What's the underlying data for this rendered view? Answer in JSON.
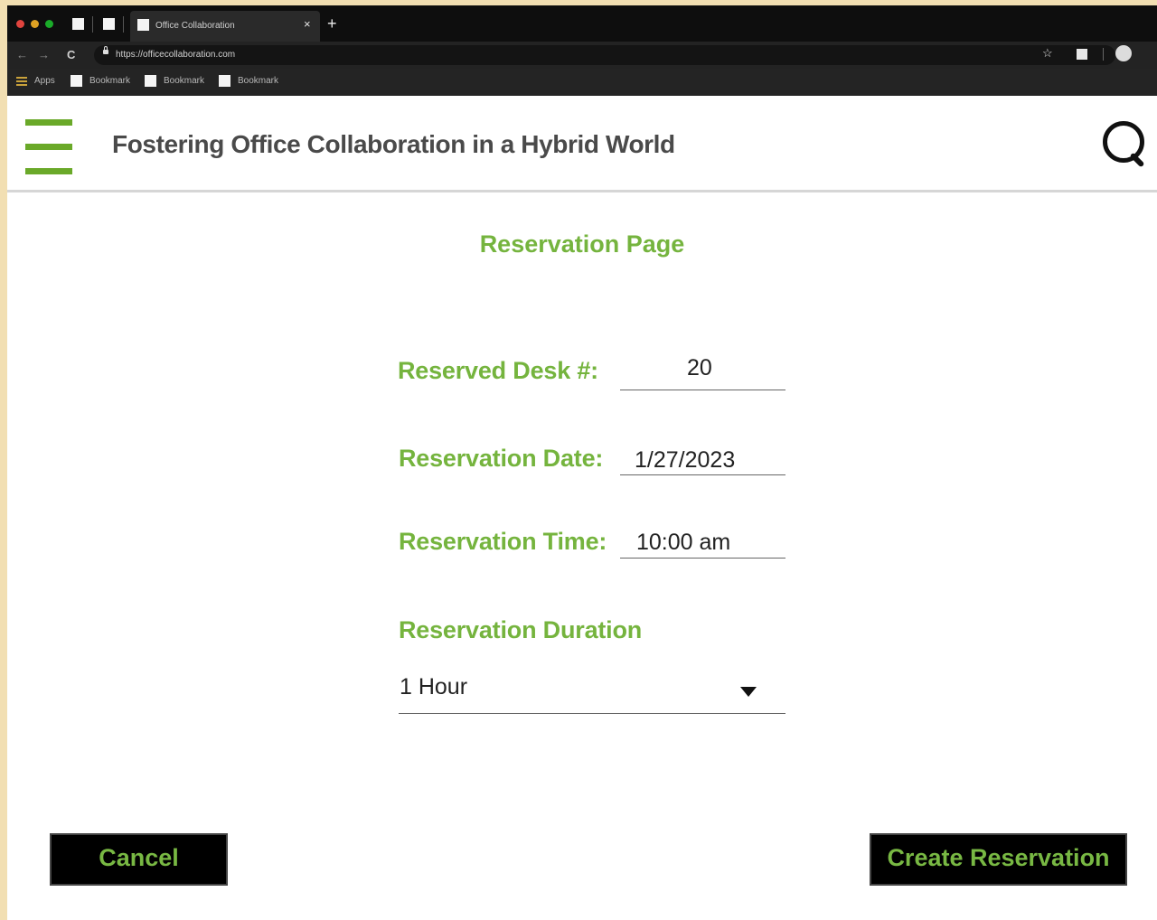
{
  "browser": {
    "tab_title": "Office Collaboration",
    "tab_close": "×",
    "new_tab": "+",
    "nav_back": "←",
    "nav_forward": "→",
    "reload": "C",
    "url": "https://officecollaboration.com",
    "bookmark_star": "☆",
    "bookmarks_bar": {
      "apps_label": "Apps",
      "items": [
        "Bookmark",
        "Bookmark",
        "Bookmark"
      ]
    },
    "colors": {
      "tabbar": "#0e0e0e",
      "toolbar": "#232323"
    }
  },
  "header": {
    "title": "Fostering Office Collaboration in a Hybrid World",
    "menu_icon": "hamburger-menu-icon",
    "search_icon": "search-icon"
  },
  "form": {
    "heading": "Reservation Page",
    "desk_label": "Reserved Desk #:",
    "desk_value": "20",
    "date_label": "Reservation Date:",
    "date_value": "1/27/2023",
    "time_label": "Reservation Time:",
    "time_value": "10:00 am",
    "duration_label": "Reservation Duration",
    "duration_value": "1 Hour"
  },
  "actions": {
    "cancel_label": "Cancel",
    "create_label": "Create Reservation"
  },
  "colors": {
    "accent_green": "#75b43e",
    "button_bg": "#000000",
    "page_bg": "#ffffff",
    "desk_bg": "#f2dfb2"
  }
}
